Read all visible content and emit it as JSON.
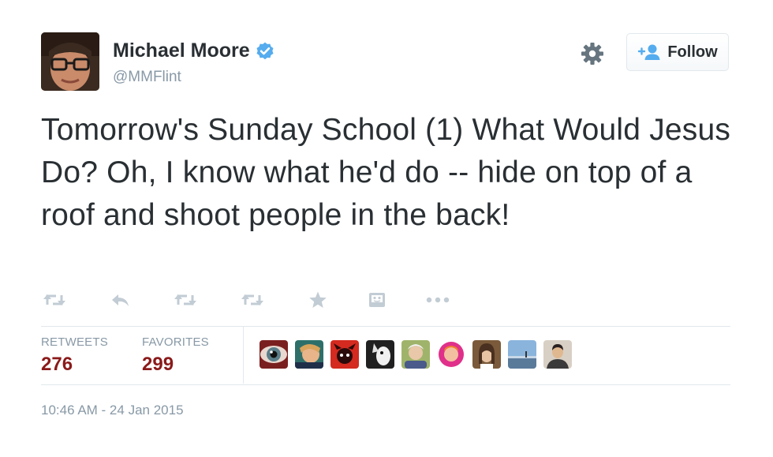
{
  "user": {
    "name": "Michael Moore",
    "handle": "@MMFlint",
    "verified": true,
    "avatar_icon": "profile-photo-avatar"
  },
  "follow_button": {
    "label": "Follow",
    "icon": "add-user-icon"
  },
  "settings_icon": "gear-icon",
  "tweet": {
    "text": "Tomorrow's Sunday School (1) What Would Jesus Do? Oh, I know what he'd do -- hide on top of a roof and shoot people in the back!"
  },
  "actions": [
    "retweet-icon",
    "reply-icon",
    "retweet-icon",
    "retweet-icon",
    "favorite-star-icon",
    "view-photo-icon",
    "more-options-icon"
  ],
  "stats": {
    "retweets_label": "RETWEETS",
    "retweets_value": "276",
    "favorites_label": "FAVORITES",
    "favorites_value": "299"
  },
  "favoriters": [
    {
      "name": "favoriter-avatar-eye",
      "color": "#7a1f1f"
    },
    {
      "name": "favoriter-avatar-2",
      "color": "#2f6f6a"
    },
    {
      "name": "favoriter-avatar-3",
      "color": "#d42a1f"
    },
    {
      "name": "favoriter-avatar-4",
      "color": "#202020"
    },
    {
      "name": "favoriter-avatar-5",
      "color": "#9fb46a"
    },
    {
      "name": "favoriter-avatar-6",
      "color": "#e0308a"
    },
    {
      "name": "favoriter-avatar-7",
      "color": "#7a5a3a"
    },
    {
      "name": "favoriter-avatar-8",
      "color": "#6f9ac4"
    },
    {
      "name": "favoriter-avatar-9",
      "color": "#d8d0c4"
    }
  ],
  "timestamp": "10:46 AM - 24 Jan 2015",
  "colors": {
    "text": "#292f33",
    "muted": "#8899a6",
    "stat_value": "#8b1a1a",
    "verified": "#55acee",
    "follow_icon": "#55acee",
    "border": "#e1e8ed",
    "action_icon": "#c2ccd4"
  }
}
